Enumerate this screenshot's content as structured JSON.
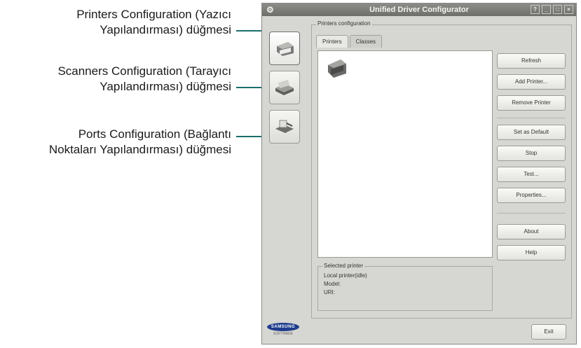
{
  "annotations": [
    {
      "line1": "Printers Configuration (Yazıcı",
      "line2": "Yapılandırması) düğmesi"
    },
    {
      "line1": "Scanners Configuration (Tarayıcı",
      "line2": "Yapılandırması) düğmesi"
    },
    {
      "line1": "Ports Configuration (Bağlantı",
      "line2": "Noktaları Yapılandırması) düğmesi"
    }
  ],
  "window": {
    "title": "Unified Driver Configurator",
    "controls": [
      "?",
      "_",
      "□",
      "×"
    ]
  },
  "sidebar": {
    "buttons": [
      {
        "icon": "printer-icon"
      },
      {
        "icon": "scanner-icon"
      },
      {
        "icon": "port-icon"
      }
    ],
    "brand": "SAMSUNG",
    "brand_sub": "SOFTWARE"
  },
  "main": {
    "group_label": "Printers configuration",
    "tabs": [
      "Printers",
      "Classes"
    ],
    "buttons": {
      "refresh": "Refresh",
      "add_printer": "Add Printer...",
      "remove_printer": "Remove Printer",
      "set_default": "Set as Default",
      "stop": "Stop",
      "test": "Test...",
      "properties": "Properties...",
      "about": "About",
      "help": "Help"
    },
    "selected_printer": {
      "label": "Selected printer",
      "line1": "Local printer(idle)",
      "line2": "Model:",
      "line3": "URI:"
    },
    "exit": "Exit"
  },
  "colors": {
    "leader": "#1a6e6a",
    "window_bg": "#d6d6d2",
    "brand": "#1e3c8c"
  }
}
